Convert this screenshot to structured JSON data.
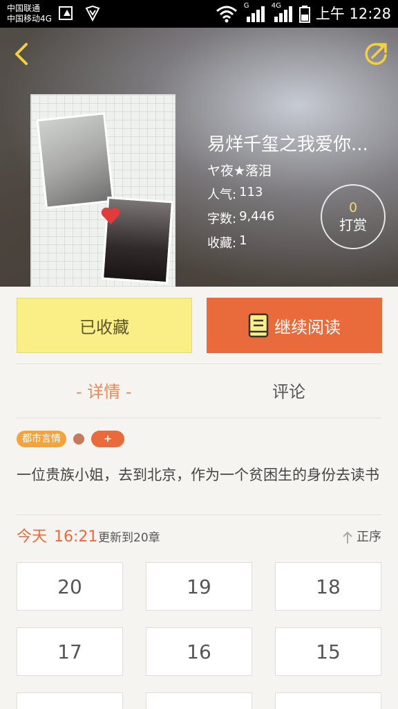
{
  "status_bar": {
    "carrier1": "中国联通",
    "carrier2": "中国移动4G",
    "network_label_g": "G",
    "network_label_4g": "4G",
    "time": "上午 12:28"
  },
  "book": {
    "title": "易烊千玺之我爱你...",
    "author": "ヤ夜★落泪",
    "popularity_label": "人气:",
    "popularity": "113",
    "words_label": "字数:",
    "words": "9,446",
    "favorites_label": "收藏:",
    "favorites": "1",
    "tip_count": "0",
    "tip_label": "打赏"
  },
  "actions": {
    "collected_label": "已收藏",
    "continue_label": "继续阅读"
  },
  "tabs": {
    "details": "- 详情 -",
    "comments": "评论"
  },
  "tags": {
    "genre": "都市言情",
    "add": "+"
  },
  "description": "一位贵族小姐，去到北京，作为一个贫困生的身份去读书",
  "update": {
    "today": "今天",
    "time": "16:21",
    "text": "更新到20章",
    "sort_label": "正序"
  },
  "chapters": [
    "20",
    "19",
    "18",
    "17",
    "16",
    "15",
    "",
    "",
    ""
  ],
  "colors": {
    "accent_orange": "#e96a3b",
    "collected_yellow": "#f9ef86",
    "back_arrow_yellow": "#f4d03f"
  },
  "icons": {
    "back": "chevron-left-icon",
    "share": "share-icon",
    "book": "book-icon",
    "sort": "arrow-up-icon"
  }
}
